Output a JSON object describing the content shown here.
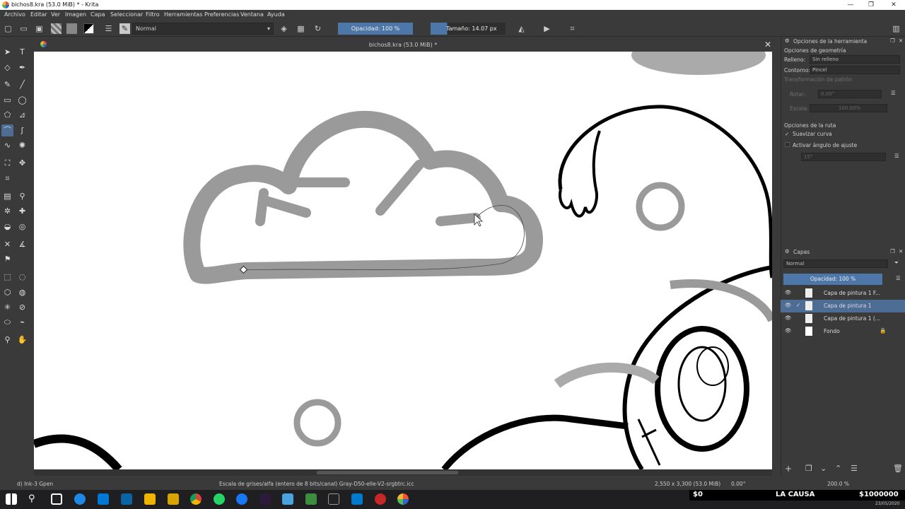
{
  "window": {
    "title": "bichos8.kra (53.0 MiB) * - Krita",
    "controls": [
      "—",
      "❐",
      "✕"
    ]
  },
  "menu": [
    "Archivo",
    "Editar",
    "Ver",
    "Imagen",
    "Capa",
    "Seleccionar",
    "Filtro",
    "Herramientas",
    "Preferencias",
    "Ventana",
    "Ayuda"
  ],
  "toolbar": {
    "blend_mode": "Normal",
    "opacity": "Opacidad: 100 %",
    "size": "Tamaño: 14.07 px"
  },
  "document": {
    "tab_title": "bichos8.kra (53.0 MiB) *"
  },
  "tool_options": {
    "header": "Opciones de la herramienta",
    "geometry_section": "Opciones de geometría",
    "fill_label": "Relleno:",
    "fill_value": "Sin relleno",
    "outline_label": "Contorno:",
    "outline_value": "Pincel",
    "pattern_transform": "Transformación de patrón",
    "rotate_label": "Rotar:",
    "rotate_value": "0.00°",
    "scale_label": "Escala:",
    "scale_value": "100.00%",
    "path_section": "Opciones de la ruta",
    "smooth_curve": "Suavizar curva",
    "snap_angle": "Activar ángulo de ajuste",
    "snap_value": "15°"
  },
  "layers": {
    "header": "Capas",
    "blend_mode": "Normal",
    "opacity": "Opacidad: 100 %",
    "items": [
      {
        "name": "Capa de pintura 1 F..."
      },
      {
        "name": "Capa de pintura 1"
      },
      {
        "name": "Capa de pintura 1 (..."
      },
      {
        "name": "Fondo"
      }
    ]
  },
  "status": {
    "brush": "d) Ink-3 Gpen",
    "color_space": "Escala de grises/alfa (entero de 8 bits/canal)  Gray-D50-elle-V2-srgbtrc.icc",
    "dimensions": "2,550 x 3,300 (53.0 MiB)",
    "rotation": "0.00°",
    "zoom": "200.0 %"
  },
  "overlay": {
    "left": "$0",
    "center": "LA CAUSA",
    "right": "$1000000"
  },
  "clock": {
    "date": "23/05/2020"
  }
}
